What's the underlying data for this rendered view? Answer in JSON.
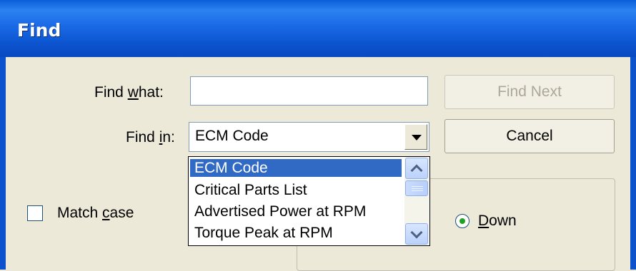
{
  "window": {
    "title": "Find"
  },
  "find_what": {
    "label": "Find what:",
    "label_prefix": "Find ",
    "mnemonic": "w",
    "label_suffix": "hat:",
    "value": ""
  },
  "find_in": {
    "label": "Find in:",
    "label_prefix": "Find ",
    "mnemonic": "i",
    "label_suffix": "n:",
    "value": "ECM Code",
    "options": [
      "ECM Code",
      "Critical Parts List",
      "Advertised Power at RPM",
      "Torque Peak at RPM"
    ],
    "selected": "ECM Code"
  },
  "buttons": {
    "find_next": "Find Next",
    "find_next_enabled": false,
    "cancel": "Cancel"
  },
  "match_case": {
    "label": "Match case",
    "label_prefix": "Match ",
    "mnemonic": "c",
    "label_suffix": "ase",
    "checked": false
  },
  "direction": {
    "selected": "Down",
    "down_label": "Down",
    "down_mnemonic": "D",
    "down_suffix": "own"
  },
  "colors": {
    "titlebar": "#0a5fd8",
    "dialog_bg": "#ece9d8",
    "selection": "#316ac5",
    "radio_dot": "#21a121"
  }
}
